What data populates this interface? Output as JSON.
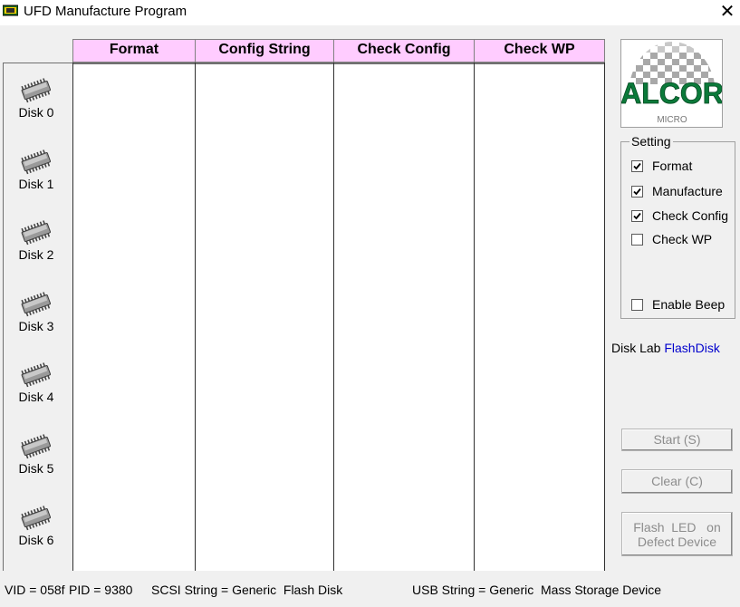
{
  "window": {
    "title": "UFD Manufacture Program",
    "close_glyph": "✕",
    "app_icon": "chip-icon"
  },
  "grid": {
    "columns": [
      "Format",
      "Config String",
      "Check Config",
      "Check WP"
    ],
    "header_color": "#ffccff",
    "disks": [
      "Disk 0",
      "Disk 1",
      "Disk 2",
      "Disk 3",
      "Disk 4",
      "Disk 5",
      "Disk 6"
    ]
  },
  "setting": {
    "legend": "Setting",
    "options": [
      {
        "label": "Format",
        "checked": true
      },
      {
        "label": "Manufacture",
        "checked": true
      },
      {
        "label": "Check Config",
        "checked": true
      },
      {
        "label": "Check WP",
        "checked": false
      }
    ],
    "enable_beep": {
      "label": "Enable Beep",
      "checked": false
    }
  },
  "disk_lab": {
    "prefix": "Disk Lab",
    "value": "FlashDisk",
    "value_color": "#0000cc"
  },
  "buttons": {
    "start": "Start (S)",
    "clear": "Clear (C)",
    "flash_led_line1": "Flash  LED   on",
    "flash_led_line2": "Defect Device"
  },
  "status": {
    "vid": "VID = 058f",
    "pid": "PID = 9380",
    "scsi": "SCSI String = Generic  Flash Disk",
    "usb": "USB String = Generic  Mass Storage Device"
  },
  "logo": {
    "text": "ALCOR",
    "subtext": "MICRO",
    "accent": "#0b7a3a"
  }
}
